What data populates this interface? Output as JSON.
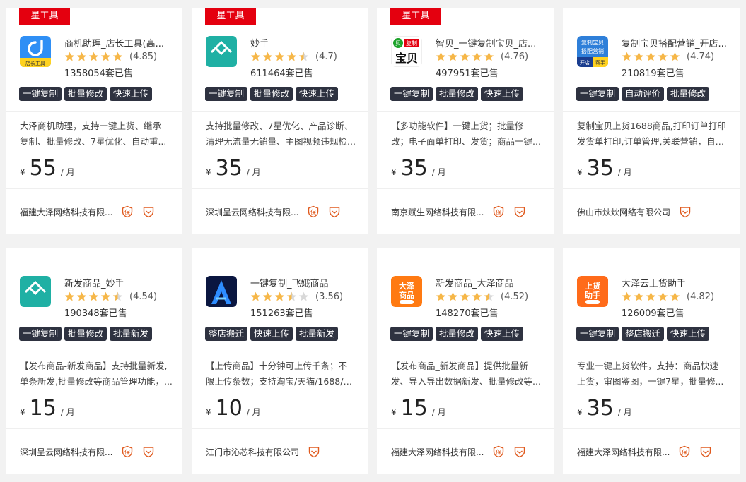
{
  "cards": [
    {
      "badge": "星工具",
      "name": "商机助理_店长工具(高...",
      "score": "(4.85)",
      "stars": 5,
      "sold": "1358054套已售",
      "tags": [
        "一键复制",
        "批量修改",
        "快速上传"
      ],
      "desc": [
        "大泽商机助理，支持一键上货、继承",
        "复制、批量修改、7星优化、自动重..."
      ],
      "currency": "¥",
      "price": "55",
      "unit": "/ 月",
      "company": "福建大泽网络科技有限...",
      "icons": [
        "bao-icon",
        "shield-icon"
      ],
      "logo_text": "店长工具",
      "logo_icon": "cloud-app-logo-icon"
    },
    {
      "badge": "星工具",
      "name": "妙手",
      "score": "(4.7)",
      "stars": 4.5,
      "sold": "611464套已售",
      "tags": [
        "一键复制",
        "批量修改",
        "快速上传"
      ],
      "desc": [
        "支持批量修改、7星优化、产品诊断、",
        "清理无流量无销量、主图视频违规检..."
      ],
      "currency": "¥",
      "price": "35",
      "unit": "/ 月",
      "company": "深圳呈云网络科技有限...",
      "icons": [
        "bao-icon",
        "shield-icon"
      ],
      "logo_text": "妙 手",
      "logo_icon": "miaoshou-logo-icon"
    },
    {
      "badge": "星工具",
      "name": "智贝_一键复制宝贝_店...",
      "score": "(4.76)",
      "stars": 5,
      "sold": "497951套已售",
      "tags": [
        "一键复制",
        "批量修改",
        "快速上传"
      ],
      "desc": [
        "【多功能软件】一键上货；批量修",
        "改；电子面单打印、发货；商品一键..."
      ],
      "currency": "¥",
      "price": "35",
      "unit": "/ 月",
      "company": "南京赋生网络科技有限...",
      "icons": [
        "bao-icon",
        "shield-icon"
      ],
      "logo_text": "复制宝贝",
      "logo_icon": "baobei-logo-icon"
    },
    {
      "badge": "",
      "name": "复制宝贝搭配营销_开店...",
      "score": "(4.74)",
      "stars": 5,
      "sold": "210819套已售",
      "tags": [
        "一键复制",
        "自动评价",
        "批量修改"
      ],
      "desc": [
        "复制宝贝上货1688商品,打印订单打印",
        "发货单打印,订单管理,关联营销，自动..."
      ],
      "currency": "¥",
      "price": "35",
      "unit": "/ 月",
      "company": "佛山市炏炏网络有限公司",
      "icons": [
        "shield-icon"
      ],
      "logo_text": "复制宝贝 搭配营销 开店 帮手",
      "logo_icon": "fuzhi-logo-icon"
    },
    {
      "badge": "",
      "name": "新发商品_妙手",
      "score": "(4.54)",
      "stars": 4.5,
      "sold": "190348套已售",
      "tags": [
        "一键复制",
        "批量修改",
        "批量新发"
      ],
      "desc": [
        "【发布商品-新发商品】支持批量新发,",
        "单条新发,批量修改等商品管理功能，..."
      ],
      "currency": "¥",
      "price": "15",
      "unit": "/ 月",
      "company": "深圳呈云网络科技有限...",
      "icons": [
        "bao-icon",
        "shield-icon"
      ],
      "logo_text": "新发商品_妙手",
      "logo_icon": "miaoshou-logo-icon"
    },
    {
      "badge": "",
      "name": "一键复制_飞娥商品",
      "score": "(3.56)",
      "stars": 3.5,
      "sold": "151263套已售",
      "tags": [
        "整店搬迁",
        "快速上传",
        "批量新发"
      ],
      "desc": [
        "【上传商品】十分钟可上传千条；不",
        "限上传条数；支持淘宝/天猫/1688/抖..."
      ],
      "currency": "¥",
      "price": "10",
      "unit": "/ 月",
      "company": "江门市沁芯科技有限公司",
      "icons": [
        "shield-icon"
      ],
      "logo_text": "A",
      "logo_icon": "feie-logo-icon"
    },
    {
      "badge": "",
      "name": "新发商品_大泽商品",
      "score": "(4.52)",
      "stars": 4.5,
      "sold": "148270套已售",
      "tags": [
        "一键复制",
        "批量修改",
        "快速上传"
      ],
      "desc": [
        "【发布商品_新发商品】提供批量新",
        "发、导入导出数据新发、批量修改等..."
      ],
      "currency": "¥",
      "price": "15",
      "unit": "/ 月",
      "company": "福建大泽网络科技有限...",
      "icons": [
        "bao-icon",
        "shield-icon"
      ],
      "logo_text": "大泽 商品",
      "logo_icon": "daze-logo-icon"
    },
    {
      "badge": "",
      "name": "大泽云上货助手",
      "score": "(4.82)",
      "stars": 5,
      "sold": "126009套已售",
      "tags": [
        "一键复制",
        "整店搬迁",
        "快速上传"
      ],
      "desc": [
        "专业一键上货软件，支持：商品快速",
        "上货，审图鉴图，一键7星，批量修..."
      ],
      "currency": "¥",
      "price": "35",
      "unit": "/ 月",
      "company": "福建大泽网络科技有限...",
      "icons": [
        "bao-icon",
        "shield-icon"
      ],
      "logo_text": "上货 助手",
      "logo_icon": "shanghuo-logo-icon"
    }
  ],
  "colors": {
    "star": "#f6b748",
    "star_empty": "#d8d8d8",
    "badge": "#e4000f",
    "tag": "#2e3240",
    "accent": "#e05a1e"
  }
}
